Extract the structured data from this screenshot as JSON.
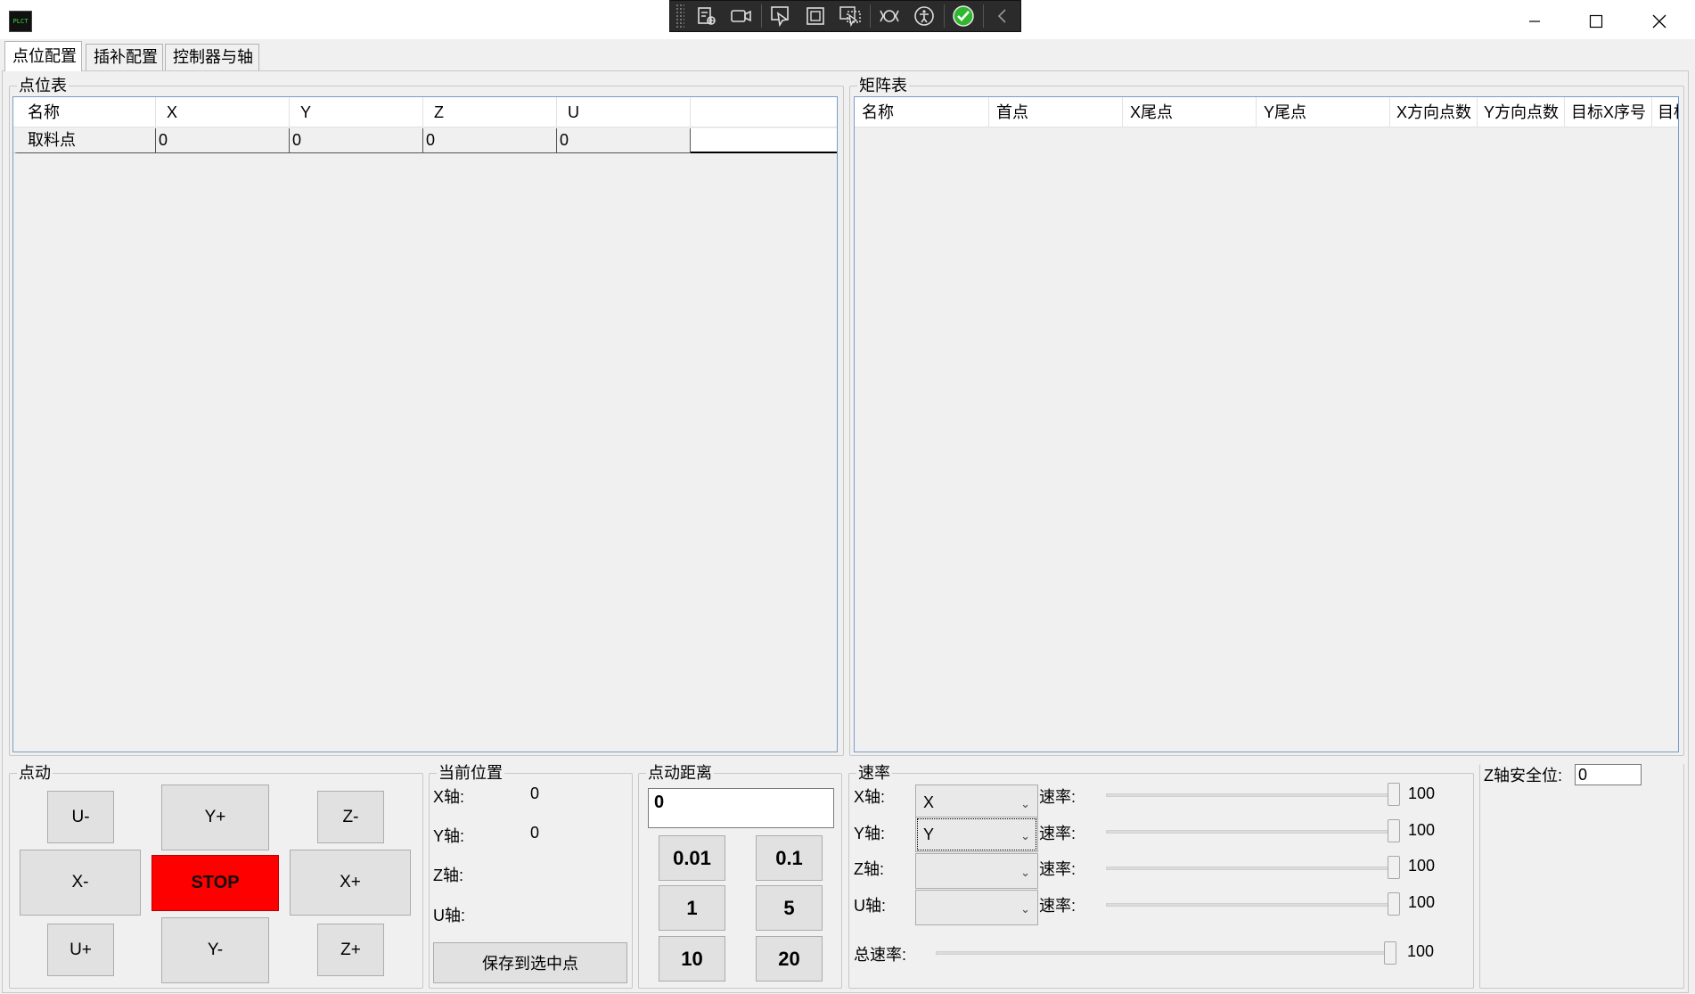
{
  "window": {
    "app_icon_text": "PLCT",
    "minimize_icon": "minimize-icon",
    "maximize_icon": "maximize-icon",
    "close_icon": "close-icon",
    "overlay_toolbar_icons": [
      "select-element-icon",
      "record-icon",
      "pointer-select-icon",
      "frame-icon",
      "track-focus-icon",
      "live-tree-icon",
      "accessibility-icon",
      "check-icon",
      "collapse-chevron-icon"
    ],
    "check_color": "#2eb82e"
  },
  "tabs": [
    {
      "label": "点位配置",
      "active": true
    },
    {
      "label": "插补配置",
      "active": false
    },
    {
      "label": "控制器与轴",
      "active": false
    }
  ],
  "point_table": {
    "title": "点位表",
    "columns": [
      "名称",
      "X",
      "Y",
      "Z",
      "U"
    ],
    "rows": [
      [
        "取料点",
        "0",
        "0",
        "0",
        "0"
      ]
    ]
  },
  "matrix_table": {
    "title": "矩阵表",
    "columns": [
      "名称",
      "首点",
      "X尾点",
      "Y尾点",
      "X方向点数",
      "Y方向点数",
      "目标X序号",
      "目标"
    ]
  },
  "jog": {
    "title": "点动",
    "buttons": {
      "u_minus": "U-",
      "y_plus": "Y+",
      "z_minus": "Z-",
      "x_minus": "X-",
      "stop": "STOP",
      "x_plus": "X+",
      "u_plus": "U+",
      "y_minus": "Y-",
      "z_plus": "Z+"
    },
    "stop_color": "#ff0000"
  },
  "current_position": {
    "title": "当前位置",
    "x_label": "X轴:",
    "x_value": "0",
    "y_label": "Y轴:",
    "y_value": "0",
    "z_label": "Z轴:",
    "z_value": "",
    "u_label": "U轴:",
    "u_value": "",
    "save_button": "保存到选中点"
  },
  "jog_distance": {
    "title": "点动距离",
    "value": "0",
    "presets": [
      "0.01",
      "0.1",
      "1",
      "5",
      "10",
      "20"
    ]
  },
  "speed": {
    "title": "速率",
    "axes": [
      {
        "label": "X轴:",
        "selected": "X",
        "rate_label": "速率:",
        "value": "100",
        "fraction": 1.0
      },
      {
        "label": "Y轴:",
        "selected": "Y",
        "rate_label": "速率:",
        "value": "100",
        "fraction": 1.0
      },
      {
        "label": "Z轴:",
        "selected": "",
        "rate_label": "速率:",
        "value": "100",
        "fraction": 1.0
      },
      {
        "label": "U轴:",
        "selected": "",
        "rate_label": "速率:",
        "value": "100",
        "fraction": 1.0
      }
    ],
    "total_label": "总速率:",
    "total_value": "100",
    "total_fraction": 1.0
  },
  "z_safe": {
    "label": "Z轴安全位:",
    "value": "0"
  }
}
